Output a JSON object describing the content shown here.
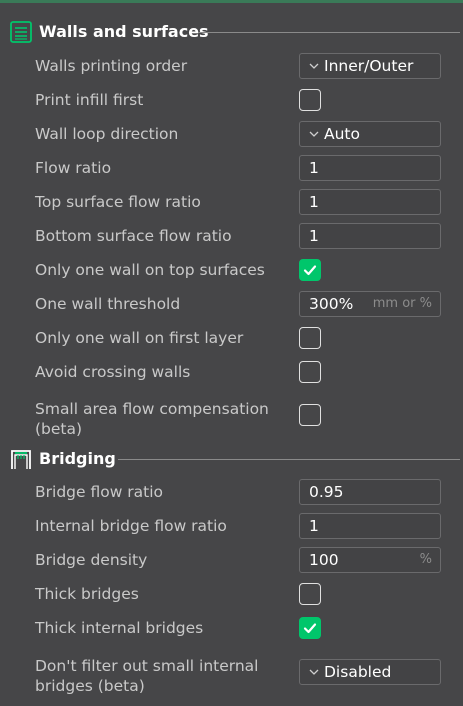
{
  "sections": [
    {
      "title": "Walls and surfaces",
      "icon": "walls-icon",
      "rows": [
        {
          "label": "Walls printing order",
          "type": "select",
          "value": "Inner/Outer"
        },
        {
          "label": "Print infill first",
          "type": "checkbox",
          "checked": false
        },
        {
          "label": "Wall loop direction",
          "type": "select",
          "value": "Auto"
        },
        {
          "label": "Flow ratio",
          "type": "input",
          "value": "1"
        },
        {
          "label": "Top surface flow ratio",
          "type": "input",
          "value": "1"
        },
        {
          "label": "Bottom surface flow ratio",
          "type": "input",
          "value": "1"
        },
        {
          "label": "Only one wall on top surfaces",
          "type": "checkbox",
          "checked": true
        },
        {
          "label": "One wall threshold",
          "type": "input",
          "value": "300%",
          "unit": "mm or %"
        },
        {
          "label": "Only one wall on first layer",
          "type": "checkbox",
          "checked": false
        },
        {
          "label": "Avoid crossing walls",
          "type": "checkbox",
          "checked": false
        },
        {
          "label": "Small area flow compensation (beta)",
          "label_lines": [
            "Small area flow compensation",
            "(beta)"
          ],
          "type": "checkbox",
          "checked": false
        }
      ]
    },
    {
      "title": "Bridging",
      "icon": "bridge-icon",
      "rows": [
        {
          "label": "Bridge flow ratio",
          "type": "input",
          "value": "0.95"
        },
        {
          "label": "Internal bridge flow ratio",
          "type": "input",
          "value": "1"
        },
        {
          "label": "Bridge density",
          "type": "input",
          "value": "100",
          "unit": "%"
        },
        {
          "label": "Thick bridges",
          "type": "checkbox",
          "checked": false
        },
        {
          "label": "Thick internal bridges",
          "type": "checkbox",
          "checked": true
        },
        {
          "label": "Don't filter out small internal bridges (beta)",
          "label_lines": [
            "Don't filter out small internal",
            "bridges (beta)"
          ],
          "type": "select",
          "value": "Disabled"
        }
      ]
    }
  ],
  "colors": {
    "accent": "#00c66b",
    "background": "#464648",
    "text": "#c9c9c9",
    "value_text": "#ffffff"
  }
}
